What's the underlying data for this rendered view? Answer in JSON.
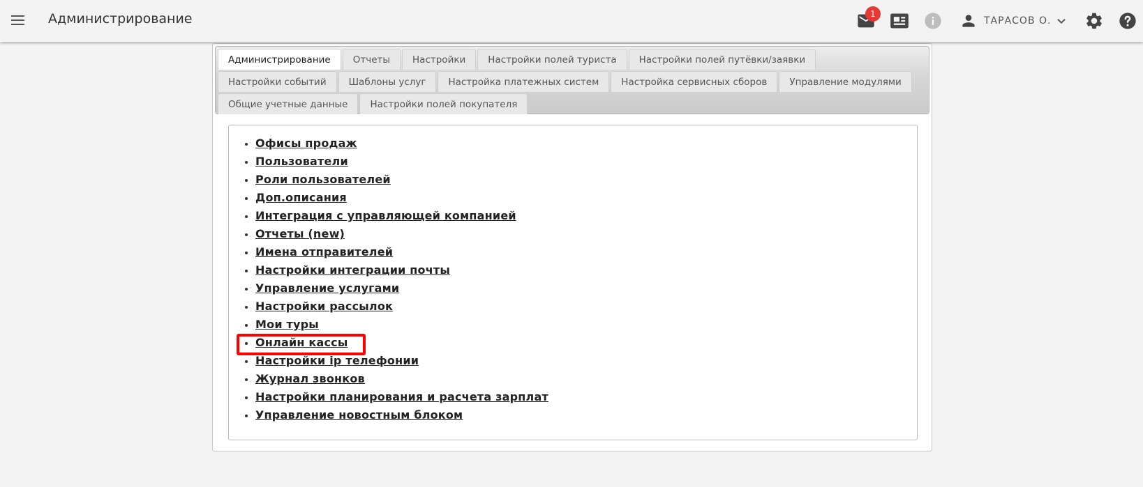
{
  "header": {
    "title": "Администрирование",
    "notification_count": "1",
    "user_name": "ТАРАСОВ О.",
    "icons": [
      "menu-icon",
      "mail-icon",
      "newspaper-icon",
      "info-icon",
      "person-icon",
      "chevron-down-icon",
      "gear-icon",
      "help-icon"
    ]
  },
  "tabs": [
    {
      "label": "Администрирование",
      "active": true
    },
    {
      "label": "Отчеты"
    },
    {
      "label": "Настройки"
    },
    {
      "label": "Настройки полей туриста"
    },
    {
      "label": "Настройки полей путёвки/заявки"
    },
    {
      "label": "Настройки событий"
    },
    {
      "label": "Шаблоны услуг"
    },
    {
      "label": "Настройка платежных систем"
    },
    {
      "label": "Настройка сервисных сборов"
    },
    {
      "label": "Управление модулями"
    },
    {
      "label": "Общие учетные данные"
    },
    {
      "label": "Настройки полей покупателя"
    }
  ],
  "links": [
    "Офисы продаж",
    "Пользователи",
    "Роли пользователей",
    "Доп.описания",
    "Интеграция с управляющей компанией",
    "Отчеты (new)",
    "Имена отправителей",
    "Настройки интеграции почты",
    "Управление услугами",
    "Настройки рассылок",
    "Мои туры",
    "Онлайн кассы",
    "Настройки ip телефонии",
    "Журнал звонков",
    "Настройки планирования и расчета зарплат",
    "Управление новостным блоком"
  ],
  "highlighted_link": "Онлайн кассы",
  "colors": {
    "badge": "#e53935",
    "highlight": "#ff0000",
    "topbar": "#f3f3f3",
    "background": "#f4f4f4"
  }
}
